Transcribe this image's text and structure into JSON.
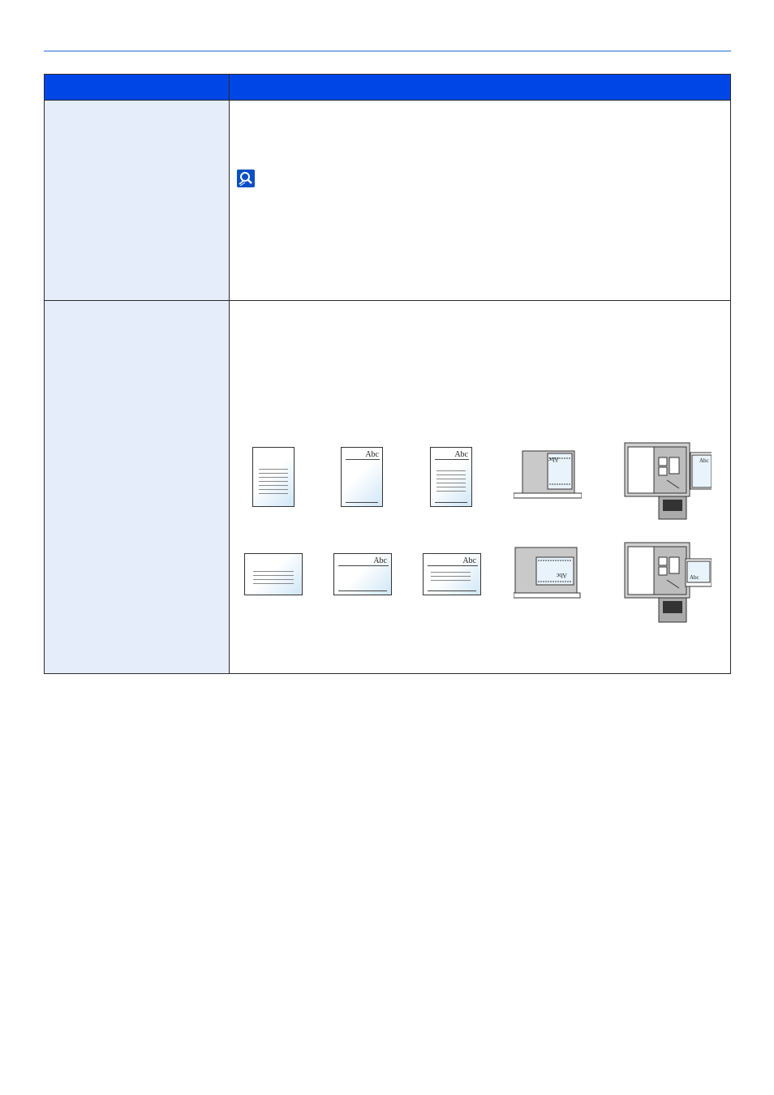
{
  "figures": {
    "abc_label": "Abc",
    "scanner_label_portrait": "Abc",
    "scanner_label_landscape": "Abc"
  },
  "icons": {
    "note": "magnifier-note-icon"
  },
  "colors": {
    "header": "#0046e6",
    "left_column": "#e5edfb",
    "rule": "#8ab0ee"
  }
}
